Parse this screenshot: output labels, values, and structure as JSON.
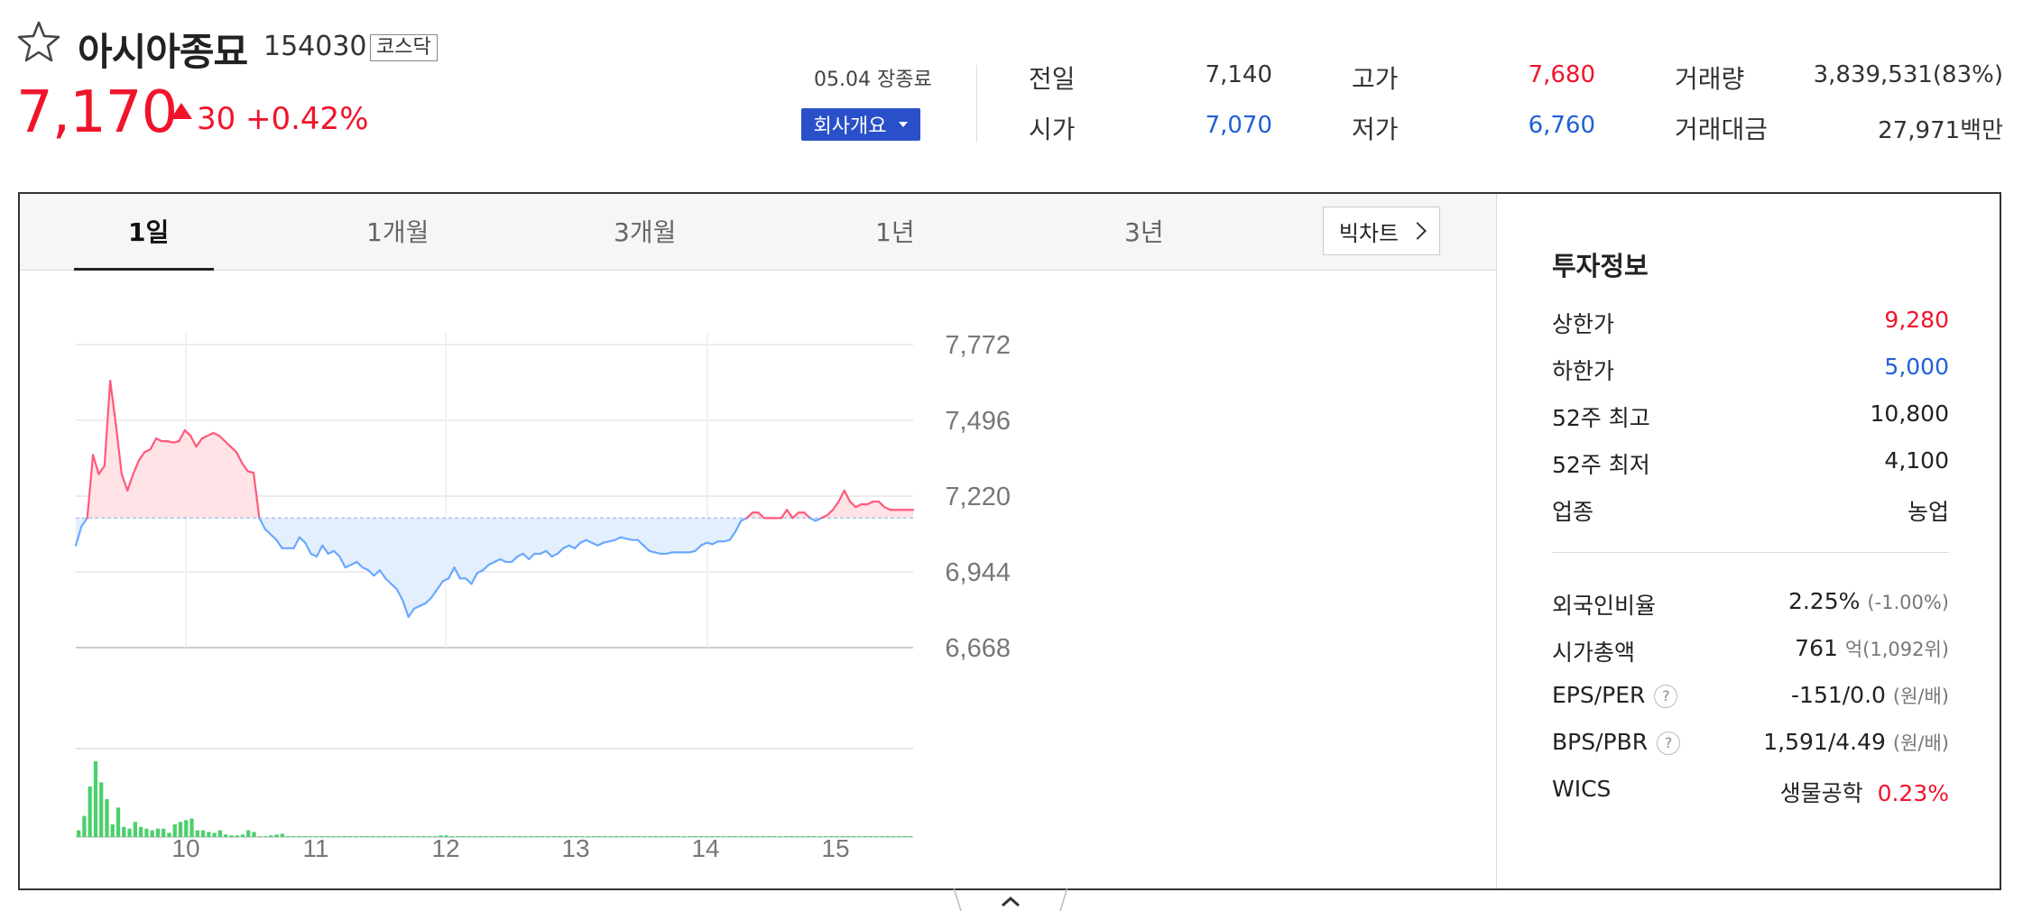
{
  "header": {
    "name": "아시아종묘",
    "code": "154030",
    "market": "코스닥",
    "price": "7,170",
    "change_value": "30",
    "change_rate": "+0.42%",
    "session": "05.04 장종료",
    "company_button": "회사개요"
  },
  "quote": {
    "prev_label": "전일",
    "prev_value": "7,140",
    "open_label": "시가",
    "open_value": "7,070",
    "high_label": "고가",
    "high_value": "7,680",
    "low_label": "저가",
    "low_value": "6,760",
    "volume_label": "거래량",
    "volume_value": "3,839,531(83%)",
    "amount_label": "거래대금",
    "amount_value": "27,971백만"
  },
  "tabs": [
    "1일",
    "1개월",
    "3개월",
    "1년",
    "3년"
  ],
  "bigchart_label": "빅차트",
  "invest": {
    "title": "투자정보",
    "rows": [
      {
        "label": "상한가",
        "value": "9,280"
      },
      {
        "label": "하한가",
        "value": "5,000"
      },
      {
        "label": "52주 최고",
        "value": "10,800"
      },
      {
        "label": "52주 최저",
        "value": "4,100"
      },
      {
        "label": "업종",
        "value": "농업"
      }
    ],
    "foreign_label": "외국인비율",
    "foreign_value": "2.25%",
    "foreign_sub": "(-1.00%)",
    "mcap_label": "시가총액",
    "mcap_value": "761",
    "mcap_sub": "억(1,092위)",
    "eps_label": "EPS/PER",
    "eps_value": "-151/0.0",
    "eps_sub": "(원/배)",
    "bps_label": "BPS/PBR",
    "bps_value": "1,591/4.49",
    "bps_sub": "(원/배)",
    "wics_label": "WICS",
    "wics_value": "생물공학",
    "wics_rate": "0.23%",
    "help_glyph": "?"
  },
  "colors": {
    "up": "#f0142b",
    "down": "#1f5fd6",
    "up_line": "#ff5a7a",
    "down_line": "#6aa8ff",
    "volume": "#4bd06c",
    "accent": "#2950c8"
  },
  "icons": {
    "favorite": "star-outline-icon",
    "up_arrow": "triangle-up-icon",
    "dropdown": "caret-down-icon",
    "bigchart": "chevron-right-icon",
    "collapse": "chevron-up-icon"
  },
  "chart_data": {
    "type": "line",
    "x_ticks": [
      "10",
      "11",
      "12",
      "13",
      "14",
      "15"
    ],
    "y_ticks": [
      "7,772",
      "7,496",
      "7,220",
      "6,944",
      "6,668"
    ],
    "ylim": [
      6668,
      7772
    ],
    "prev_close": 7140,
    "price": [
      7040,
      7110,
      7140,
      7370,
      7300,
      7330,
      7640,
      7480,
      7300,
      7240,
      7300,
      7350,
      7380,
      7390,
      7430,
      7420,
      7420,
      7415,
      7420,
      7460,
      7440,
      7400,
      7430,
      7440,
      7450,
      7440,
      7420,
      7400,
      7380,
      7340,
      7310,
      7305,
      7140,
      7100,
      7080,
      7060,
      7030,
      7030,
      7030,
      7070,
      7050,
      7010,
      7000,
      7040,
      7010,
      7020,
      7000,
      6960,
      6970,
      6980,
      6960,
      6950,
      6930,
      6950,
      6920,
      6900,
      6880,
      6840,
      6780,
      6810,
      6820,
      6830,
      6850,
      6880,
      6910,
      6920,
      6960,
      6920,
      6920,
      6900,
      6940,
      6950,
      6970,
      6980,
      6990,
      6980,
      6980,
      7000,
      7010,
      6990,
      7010,
      7010,
      7020,
      7000,
      7010,
      7030,
      7040,
      7030,
      7050,
      7060,
      7050,
      7040,
      7050,
      7055,
      7060,
      7070,
      7065,
      7060,
      7060,
      7040,
      7020,
      7015,
      7010,
      7010,
      7015,
      7015,
      7015,
      7015,
      7020,
      7040,
      7050,
      7045,
      7055,
      7055,
      7060,
      7090,
      7130,
      7140,
      7160,
      7160,
      7140,
      7140,
      7140,
      7140,
      7170,
      7140,
      7160,
      7160,
      7140,
      7130,
      7140,
      7150,
      7170,
      7200,
      7240,
      7200,
      7180,
      7190,
      7190,
      7200,
      7200,
      7180,
      7170,
      7170,
      7170,
      7170,
      7170
    ],
    "volume": [
      8,
      25,
      60,
      90,
      65,
      45,
      15,
      35,
      12,
      10,
      18,
      12,
      10,
      8,
      10,
      10,
      5,
      15,
      18,
      20,
      22,
      8,
      8,
      6,
      5,
      8,
      3,
      2,
      2,
      3,
      8,
      6,
      1,
      1,
      2,
      3,
      4,
      1,
      1,
      1,
      1,
      1,
      1,
      1,
      1,
      1,
      1,
      1,
      1,
      1,
      1,
      1,
      1,
      1,
      1,
      1,
      1,
      1,
      1,
      1,
      1,
      1,
      1,
      1,
      2,
      2,
      1,
      1,
      1,
      1,
      1,
      1,
      1,
      1,
      1,
      1,
      1,
      1,
      1,
      1,
      1,
      1,
      1,
      1,
      1,
      1,
      1,
      1,
      1,
      1,
      1,
      1,
      1,
      1,
      1,
      1,
      1,
      1,
      1,
      1,
      1,
      1,
      1,
      1,
      1,
      1,
      1,
      1,
      1,
      1,
      1,
      1,
      1,
      1,
      1,
      1,
      1,
      1,
      1,
      1,
      1,
      1,
      1,
      1,
      1,
      1,
      1,
      1,
      1,
      1,
      1,
      1,
      1,
      1,
      1,
      1,
      1,
      1,
      1,
      1,
      1,
      1,
      1,
      1,
      1,
      1,
      1,
      1
    ],
    "volume_notes": "relative bar heights",
    "series": [
      {
        "values": []
      }
    ]
  }
}
